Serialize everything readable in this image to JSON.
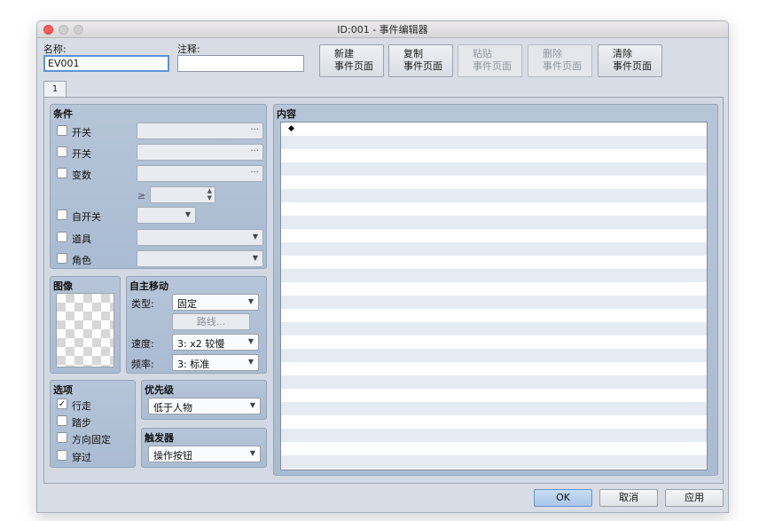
{
  "window": {
    "title": "ID:001 - 事件编辑器"
  },
  "header": {
    "name_label": "名称:",
    "name_value": "EV001",
    "note_label": "注释:",
    "note_value": ""
  },
  "toolbar": [
    {
      "line1": "新建",
      "line2": "事件页面",
      "enabled": true
    },
    {
      "line1": "复制",
      "line2": "事件页面",
      "enabled": true
    },
    {
      "line1": "粘贴",
      "line2": "事件页面",
      "enabled": false
    },
    {
      "line1": "删除",
      "line2": "事件页面",
      "enabled": false
    },
    {
      "line1": "清除",
      "line2": "事件页面",
      "enabled": true
    }
  ],
  "tabs": [
    {
      "label": "1"
    }
  ],
  "conditions": {
    "title": "条件",
    "switch1": "开关",
    "switch2": "开关",
    "variable": "变数",
    "geq": "≥",
    "self_switch": "自开关",
    "item": "道具",
    "actor": "角色"
  },
  "image": {
    "title": "图像"
  },
  "movement": {
    "title": "自主移动",
    "type_label": "类型:",
    "type_value": "固定",
    "route_label": "路线...",
    "speed_label": "速度:",
    "speed_value": "3: x2 较慢",
    "freq_label": "频率:",
    "freq_value": "3: 标准"
  },
  "options": {
    "title": "选项",
    "walk": "行走",
    "walk_checked": "✓",
    "step": "踏步",
    "dir_fix": "方向固定",
    "through": "穿过"
  },
  "priority": {
    "title": "优先级",
    "value": "低于人物"
  },
  "trigger": {
    "title": "触发器",
    "value": "操作按钮"
  },
  "contents": {
    "title": "内容",
    "first_line": "◆"
  },
  "footer": {
    "ok": "OK",
    "cancel": "取消",
    "apply": "应用"
  }
}
